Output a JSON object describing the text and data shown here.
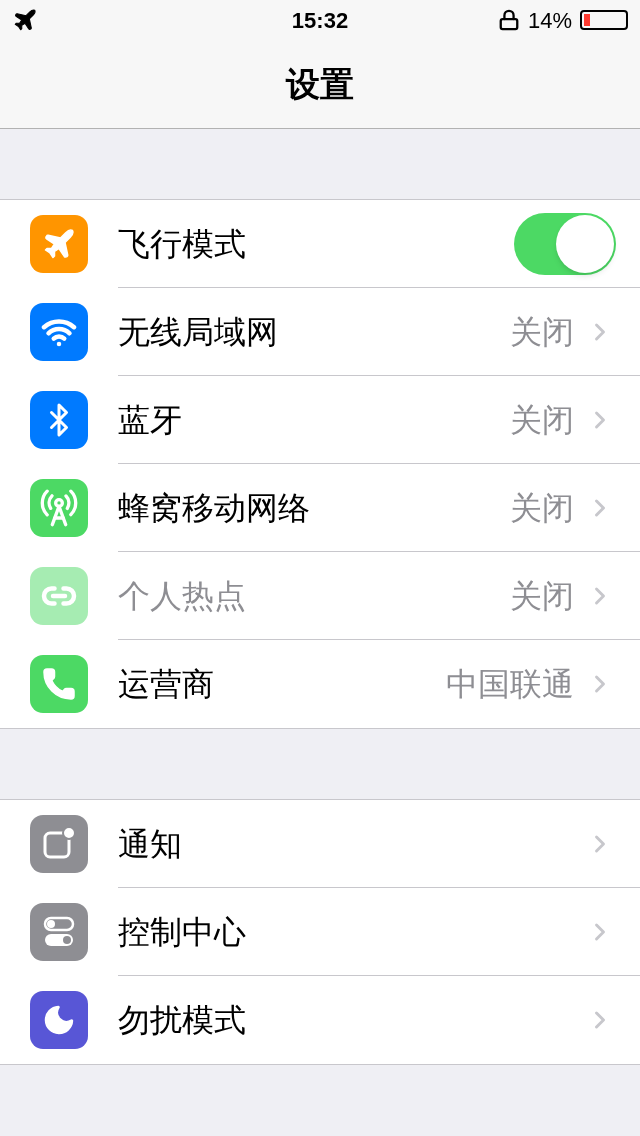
{
  "status_bar": {
    "time": "15:32",
    "battery": "14%"
  },
  "nav": {
    "title": "设置"
  },
  "sections": [
    {
      "items": [
        {
          "kind": "toggle",
          "color": "#ff9500",
          "label": "飞行模式",
          "on": true,
          "disabled": false
        },
        {
          "kind": "link",
          "color": "#007aff",
          "label": "无线局域网",
          "value": "关闭",
          "disabled": false
        },
        {
          "kind": "link",
          "color": "#007aff",
          "label": "蓝牙",
          "value": "关闭",
          "disabled": false
        },
        {
          "kind": "link",
          "color": "#4cd964",
          "label": "蜂窝移动网络",
          "value": "关闭",
          "disabled": false
        },
        {
          "kind": "link",
          "color": "#a6ecb2",
          "label": "个人热点",
          "value": "关闭",
          "disabled": true
        },
        {
          "kind": "link",
          "color": "#4cd964",
          "label": "运营商",
          "value": "中国联通",
          "disabled": false
        }
      ]
    },
    {
      "items": [
        {
          "kind": "link",
          "color": "#8e8e93",
          "label": "通知",
          "disabled": false
        },
        {
          "kind": "link",
          "color": "#8e8e93",
          "label": "控制中心",
          "disabled": false
        },
        {
          "kind": "link",
          "color": "#5856d6",
          "label": "勿扰模式",
          "disabled": false
        }
      ]
    }
  ]
}
